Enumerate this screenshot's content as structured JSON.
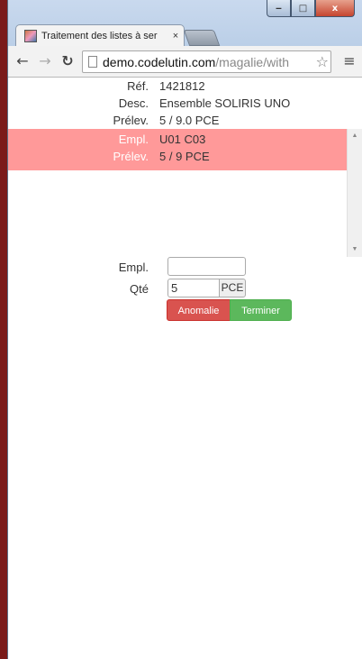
{
  "browser": {
    "tab_title": "Traitement des listes à ser",
    "tab_close": "×",
    "url_host": "demo.codelutin.com",
    "url_path": "/magalie/with",
    "window_minimize": "‒",
    "window_maximize": "□",
    "window_close": "x"
  },
  "item": {
    "ref_label": "Réf.",
    "ref_value": "1421812",
    "desc_label": "Desc.",
    "desc_value": "Ensemble SOLIRIS UNO",
    "prelev_label": "Prélev.",
    "prelev_value": "5 / 9.0 PCE"
  },
  "locations": [
    {
      "empl_label": "Empl.",
      "empl_value": "U01 C03",
      "prelev_label": "Prélev.",
      "prelev_value": "5 / 9 PCE"
    }
  ],
  "form": {
    "empl_label": "Empl.",
    "empl_value": "",
    "qte_label": "Qté",
    "qte_value": "5",
    "qte_unit": "PCE",
    "anomalie_label": "Anomalie",
    "terminer_label": "Terminer"
  },
  "colors": {
    "highlight": "#ff9999",
    "anomalie": "#d9534f",
    "terminer": "#5cb85c"
  }
}
